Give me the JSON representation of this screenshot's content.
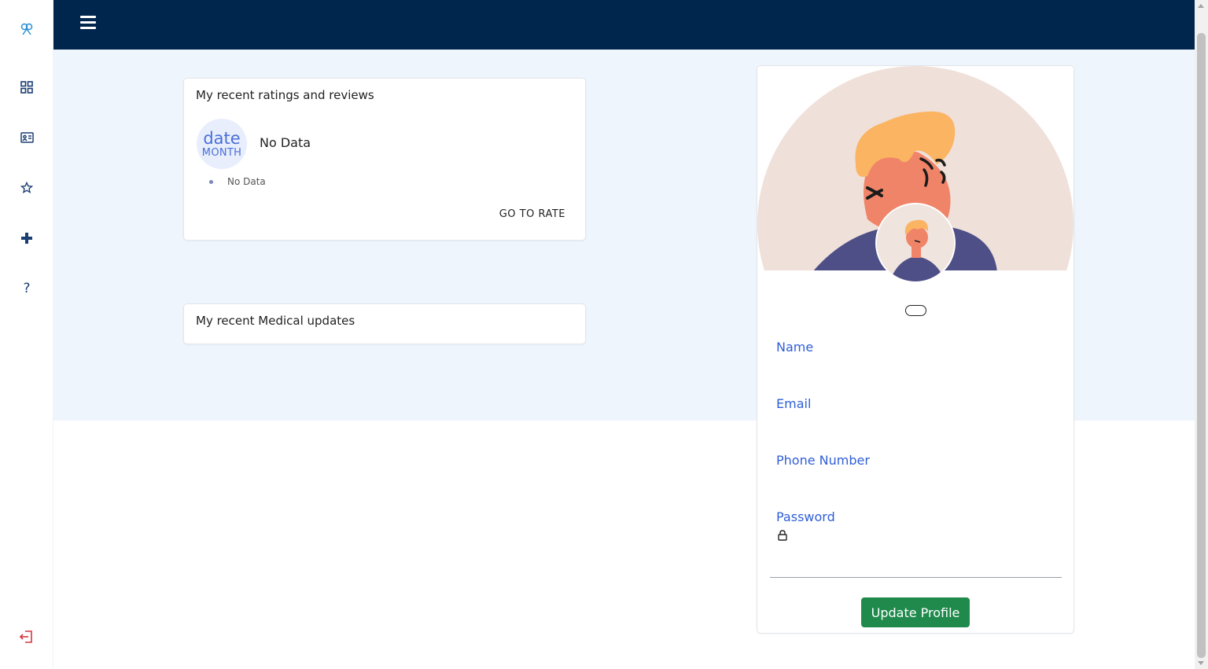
{
  "sidebar": {
    "items": [
      {
        "name": "logo-icon"
      },
      {
        "name": "dashboard-icon"
      },
      {
        "name": "id-card-icon"
      },
      {
        "name": "star-icon"
      },
      {
        "name": "plus-icon"
      },
      {
        "name": "help-icon",
        "glyph": "?"
      },
      {
        "name": "logout-icon"
      }
    ]
  },
  "topbar": {
    "menu_icon": "hamburger-icon",
    "color": "#00264d"
  },
  "ratings": {
    "title": "My recent ratings and reviews",
    "date_top": "date",
    "date_bottom": "MONTH",
    "no_data_main": "No Data",
    "no_data_item": "No Data",
    "go_to_rate": "GO TO RATE"
  },
  "medical": {
    "title": "My recent Medical updates"
  },
  "profile": {
    "fields": {
      "name_label": "Name",
      "email_label": "Email",
      "phone_label": "Phone Number",
      "password_label": "Password"
    },
    "update_button": "Update Profile"
  },
  "colors": {
    "accent": "#2f5fd6",
    "button": "#1f8a4c",
    "logout": "#d9343e"
  }
}
